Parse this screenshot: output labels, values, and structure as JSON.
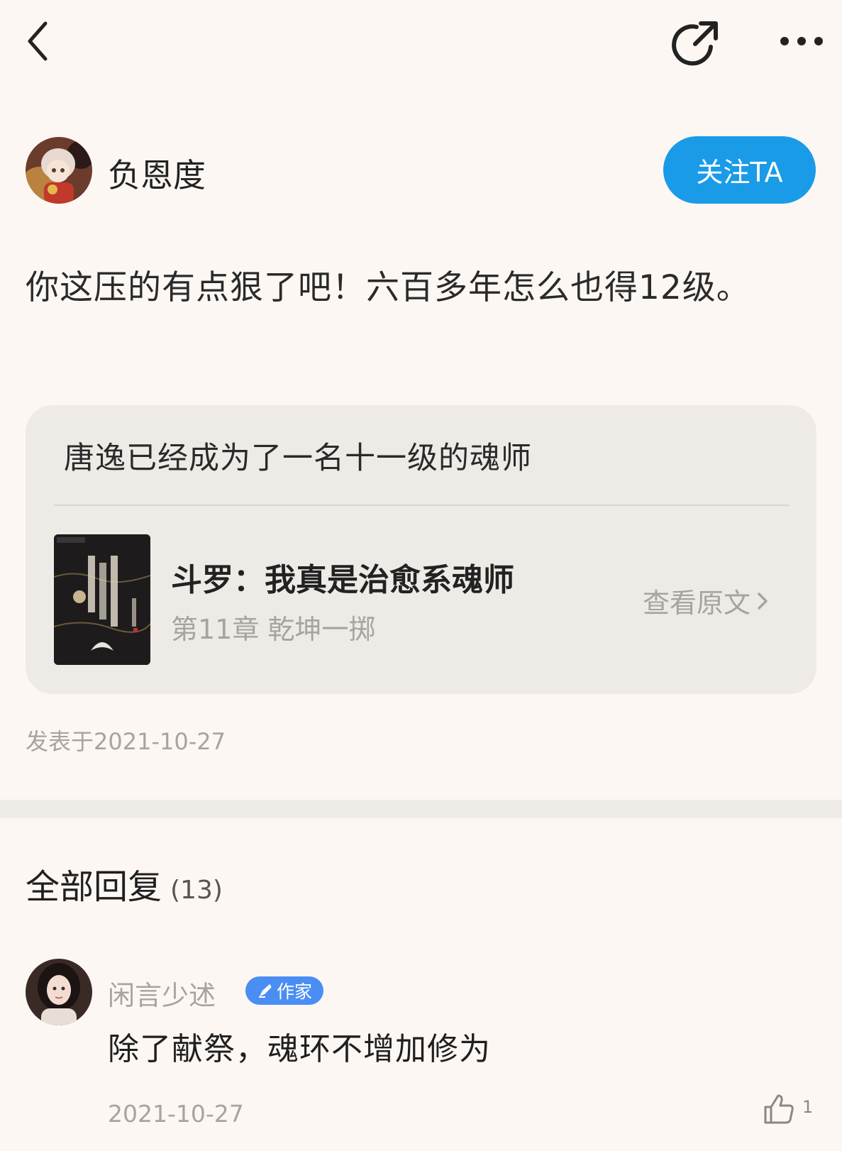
{
  "topbar": {
    "back_icon": "chevron-left-icon",
    "share_icon": "share-refresh-icon",
    "more_icon": "more-dots-icon"
  },
  "author": {
    "name": "负恩度",
    "follow_label": "关注TA"
  },
  "post": {
    "text": "你这压的有点狠了吧！六百多年怎么也得12级。",
    "date": "发表于2021-10-27"
  },
  "quote": {
    "text": "唐逸已经成为了一名十一级的魂师",
    "book_title": "斗罗：我真是治愈系魂师",
    "chapter": "第11章 乾坤一掷",
    "view_original_label": "查看原文"
  },
  "replies": {
    "heading": "全部回复",
    "count": "(13)",
    "items": [
      {
        "name": "闲言少述",
        "badge": "作家",
        "text": "除了献祭，魂环不增加修为",
        "date": "2021-10-27",
        "likes": "1"
      }
    ]
  },
  "colors": {
    "background": "#fdf7f3",
    "accent": "#1a9be8",
    "badge": "#4b8ef3"
  }
}
